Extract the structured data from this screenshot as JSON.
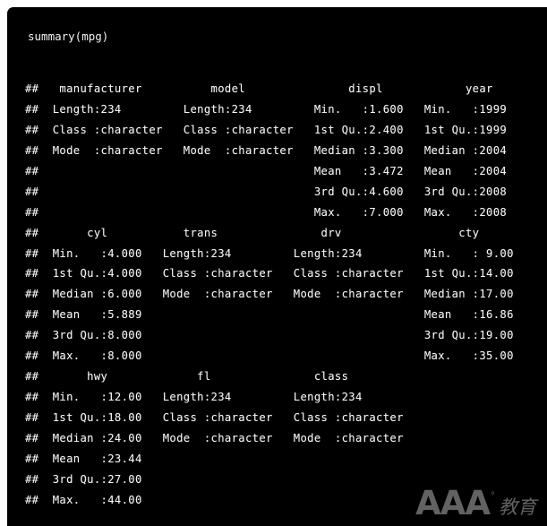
{
  "console": {
    "prompt_line": "summary(mpg)",
    "comment_prefix": "##",
    "text_color": "#f5f5f5",
    "background_color": "#000000",
    "page_background": "#ffffff"
  },
  "output_lines": [
    "##   manufacturer          model               displ            year     ",
    "##  Length:234         Length:234         Min.   :1.600   Min.   :1999  ",
    "##  Class :character   Class :character   1st Qu.:2.400   1st Qu.:1999  ",
    "##  Mode  :character   Mode  :character   Median :3.300   Median :2004  ",
    "##                                        Mean   :3.472   Mean   :2004  ",
    "##                                        3rd Qu.:4.600   3rd Qu.:2008  ",
    "##                                        Max.   :7.000   Max.   :2008  ",
    "##       cyl           trans               drv                 cty      ",
    "##  Min.   :4.000   Length:234         Length:234         Min.   : 9.00 ",
    "##  1st Qu.:4.000   Class :character   Class :character   1st Qu.:14.00 ",
    "##  Median :6.000   Mode  :character   Mode  :character   Median :17.00 ",
    "##  Mean   :5.889                                         Mean   :16.86 ",
    "##  3rd Qu.:8.000                                         3rd Qu.:19.00 ",
    "##  Max.   :8.000                                         Max.   :35.00 ",
    "##       hwy             fl               class          ",
    "##  Min.   :12.00   Length:234         Length:234        ",
    "##  1st Qu.:18.00   Class :character   Class :character  ",
    "##  Median :24.00   Mode  :character   Mode  :character  ",
    "##  Mean   :23.44                                        ",
    "##  3rd Qu.:27.00                                        ",
    "##  Max.   :44.00                                        "
  ],
  "watermark": {
    "logo_text": "AAA",
    "degree_mark": "°",
    "cn_text": "教育",
    "color": "#6b6b6b"
  },
  "summary_table": {
    "variables": [
      {
        "name": "manufacturer",
        "type": "character",
        "stats": {
          "Length": "234",
          "Class": "character",
          "Mode": "character"
        }
      },
      {
        "name": "model",
        "type": "character",
        "stats": {
          "Length": "234",
          "Class": "character",
          "Mode": "character"
        }
      },
      {
        "name": "displ",
        "type": "numeric",
        "stats": {
          "Min.": "1.600",
          "1st Qu.": "2.400",
          "Median": "3.300",
          "Mean": "3.472",
          "3rd Qu.": "4.600",
          "Max.": "7.000"
        }
      },
      {
        "name": "year",
        "type": "numeric",
        "stats": {
          "Min.": "1999",
          "1st Qu.": "1999",
          "Median": "2004",
          "Mean": "2004",
          "3rd Qu.": "2008",
          "Max.": "2008"
        }
      },
      {
        "name": "cyl",
        "type": "numeric",
        "stats": {
          "Min.": "4.000",
          "1st Qu.": "4.000",
          "Median": "6.000",
          "Mean": "5.889",
          "3rd Qu.": "8.000",
          "Max.": "8.000"
        }
      },
      {
        "name": "trans",
        "type": "character",
        "stats": {
          "Length": "234",
          "Class": "character",
          "Mode": "character"
        }
      },
      {
        "name": "drv",
        "type": "character",
        "stats": {
          "Length": "234",
          "Class": "character",
          "Mode": "character"
        }
      },
      {
        "name": "cty",
        "type": "numeric",
        "stats": {
          "Min.": " 9.00",
          "1st Qu.": "14.00",
          "Median": "17.00",
          "Mean": "16.86",
          "3rd Qu.": "19.00",
          "Max.": "35.00"
        }
      },
      {
        "name": "hwy",
        "type": "numeric",
        "stats": {
          "Min.": "12.00",
          "1st Qu.": "18.00",
          "Median": "24.00",
          "Mean": "23.44",
          "3rd Qu.": "27.00",
          "Max.": "44.00"
        }
      },
      {
        "name": "fl",
        "type": "character",
        "stats": {
          "Length": "234",
          "Class": "character",
          "Mode": "character"
        }
      },
      {
        "name": "class",
        "type": "character",
        "stats": {
          "Length": "234",
          "Class": "character",
          "Mode": "character"
        }
      }
    ]
  }
}
